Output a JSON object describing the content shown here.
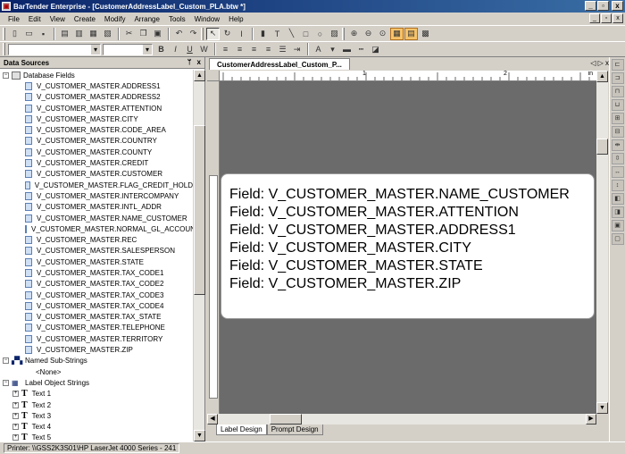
{
  "window": {
    "title": "BarTender Enterprise - [CustomerAddressLabel_Custom_PLA.btw *]",
    "min_glyph": "_",
    "max_glyph": "▫",
    "close_glyph": "x"
  },
  "menu": [
    {
      "label": "File"
    },
    {
      "label": "Edit"
    },
    {
      "label": "View"
    },
    {
      "label": "Create"
    },
    {
      "label": "Modify"
    },
    {
      "label": "Arrange"
    },
    {
      "label": "Tools"
    },
    {
      "label": "Window"
    },
    {
      "label": "Help"
    }
  ],
  "format_toolbar": {
    "bold": "B",
    "italic": "I",
    "underline": "U",
    "word": "W"
  },
  "data_sources": {
    "title": "Data Sources",
    "pin": "ᛘ",
    "close": "x",
    "database_fields_label": "Database Fields",
    "fields": [
      "V_CUSTOMER_MASTER.ADDRESS1",
      "V_CUSTOMER_MASTER.ADDRESS2",
      "V_CUSTOMER_MASTER.ATTENTION",
      "V_CUSTOMER_MASTER.CITY",
      "V_CUSTOMER_MASTER.CODE_AREA",
      "V_CUSTOMER_MASTER.COUNTRY",
      "V_CUSTOMER_MASTER.COUNTY",
      "V_CUSTOMER_MASTER.CREDIT",
      "V_CUSTOMER_MASTER.CUSTOMER",
      "V_CUSTOMER_MASTER.FLAG_CREDIT_HOLD",
      "V_CUSTOMER_MASTER.INTERCOMPANY",
      "V_CUSTOMER_MASTER.INTL_ADDR",
      "V_CUSTOMER_MASTER.NAME_CUSTOMER",
      "V_CUSTOMER_MASTER.NORMAL_GL_ACCOUNT",
      "V_CUSTOMER_MASTER.REC",
      "V_CUSTOMER_MASTER.SALESPERSON",
      "V_CUSTOMER_MASTER.STATE",
      "V_CUSTOMER_MASTER.TAX_CODE1",
      "V_CUSTOMER_MASTER.TAX_CODE2",
      "V_CUSTOMER_MASTER.TAX_CODE3",
      "V_CUSTOMER_MASTER.TAX_CODE4",
      "V_CUSTOMER_MASTER.TAX_STATE",
      "V_CUSTOMER_MASTER.TELEPHONE",
      "V_CUSTOMER_MASTER.TERRITORY",
      "V_CUSTOMER_MASTER.ZIP"
    ],
    "named_substrings_label": "Named Sub-Strings",
    "none_label": "<None>",
    "label_object_strings_label": "Label Object Strings",
    "text_objects": [
      "Text 1",
      "Text 2",
      "Text 3",
      "Text 4",
      "Text 5"
    ]
  },
  "document": {
    "tab_label": "CustomerAddressLabel_Custom_P...",
    "nav": "◁ ▷ x",
    "ruler_numbers": [
      "1",
      "2"
    ],
    "ruler_unit": "in",
    "label_lines": [
      "Field: V_CUSTOMER_MASTER.NAME_CUSTOMER",
      "Field: V_CUSTOMER_MASTER.ATTENTION",
      "Field: V_CUSTOMER_MASTER.ADDRESS1",
      "Field: V_CUSTOMER_MASTER.CITY",
      "Field: V_CUSTOMER_MASTER.STATE",
      "Field: V_CUSTOMER_MASTER.ZIP"
    ],
    "bottom_tabs": [
      "Label Design",
      "Prompt Design"
    ]
  },
  "status": {
    "printer": "Printer: \\\\GSS2K3S01\\HP LaserJet 4000 Series - 241"
  },
  "colors": {
    "titlebar": "#0a246a",
    "canvas": "#6b6b6b",
    "chrome": "#d4d0c8"
  }
}
